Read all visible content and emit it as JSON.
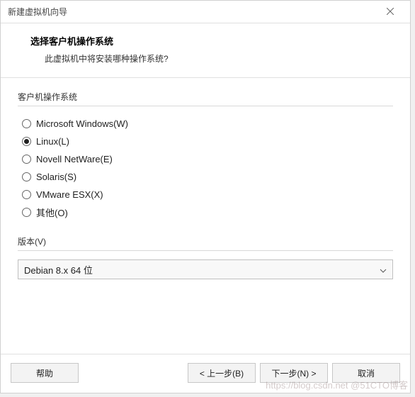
{
  "titlebar": {
    "title": "新建虚拟机向导"
  },
  "header": {
    "title": "选择客户机操作系统",
    "subtitle": "此虚拟机中将安装哪种操作系统?"
  },
  "os_group": {
    "label": "客户机操作系统",
    "options": [
      {
        "label": "Microsoft Windows(W)",
        "selected": false
      },
      {
        "label": "Linux(L)",
        "selected": true
      },
      {
        "label": "Novell NetWare(E)",
        "selected": false
      },
      {
        "label": "Solaris(S)",
        "selected": false
      },
      {
        "label": "VMware ESX(X)",
        "selected": false
      },
      {
        "label": "其他(O)",
        "selected": false
      }
    ]
  },
  "version": {
    "label": "版本(V)",
    "selected": "Debian 8.x 64 位"
  },
  "buttons": {
    "help": "帮助",
    "back": "< 上一步(B)",
    "next": "下一步(N) >",
    "cancel": "取消"
  },
  "watermark": "https://blog.csdn.net @51CTO博客"
}
